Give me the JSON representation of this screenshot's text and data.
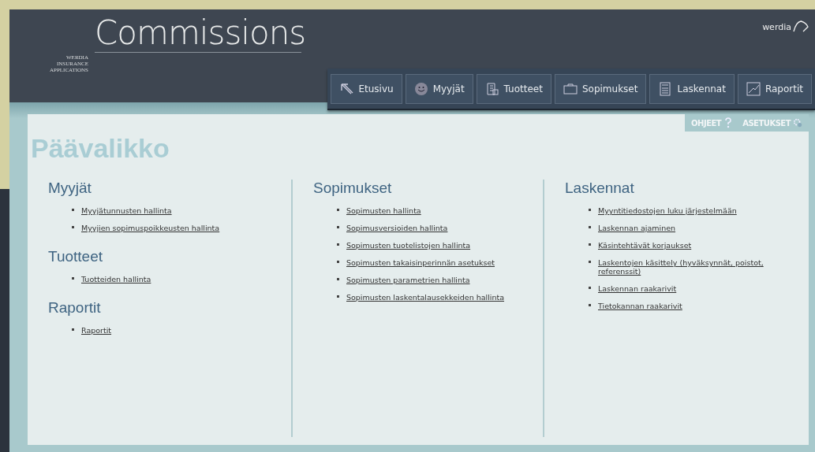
{
  "header": {
    "title": "Commissions",
    "subtitle_lines": [
      "WERDIA",
      "INSURANCE",
      "APPLICATIONS"
    ],
    "logo": "werdia"
  },
  "nav": [
    {
      "label": "Etusivu"
    },
    {
      "label": "Myyjät"
    },
    {
      "label": "Tuotteet"
    },
    {
      "label": "Sopimukset"
    },
    {
      "label": "Laskennat"
    },
    {
      "label": "Raportit"
    }
  ],
  "utility_links": [
    {
      "label": "OHJEET"
    },
    {
      "label": "ASETUKSET"
    }
  ],
  "page_title": "Päävalikko",
  "columns": [
    {
      "sections": [
        {
          "heading": "Myyjät",
          "links": [
            "Myyjätunnusten hallinta",
            "Myyjien sopimuspoikkeusten hallinta"
          ]
        },
        {
          "heading": "Tuotteet",
          "links": [
            "Tuotteiden hallinta"
          ]
        },
        {
          "heading": "Raportit",
          "links": [
            "Raportit"
          ]
        }
      ]
    },
    {
      "sections": [
        {
          "heading": "Sopimukset",
          "links": [
            "Sopimusten hallinta",
            "Sopimusversioiden hallinta",
            "Sopimusten tuotelistojen hallinta",
            "Sopimusten takaisinperinnän asetukset",
            "Sopimusten parametrien hallinta",
            "Sopimusten laskentalausekkeiden hallinta"
          ]
        }
      ]
    },
    {
      "sections": [
        {
          "heading": "Laskennat",
          "links": [
            "Myyntitiedostojen luku järjestelmään",
            "Laskennan ajaminen",
            "Käsintehtävät korjaukset",
            "Laskentojen käsittely (hyväksynnät, poistot, referenssit)",
            "Laskennan raakarivit",
            "Tietokannan raakarivit"
          ]
        }
      ]
    }
  ]
}
